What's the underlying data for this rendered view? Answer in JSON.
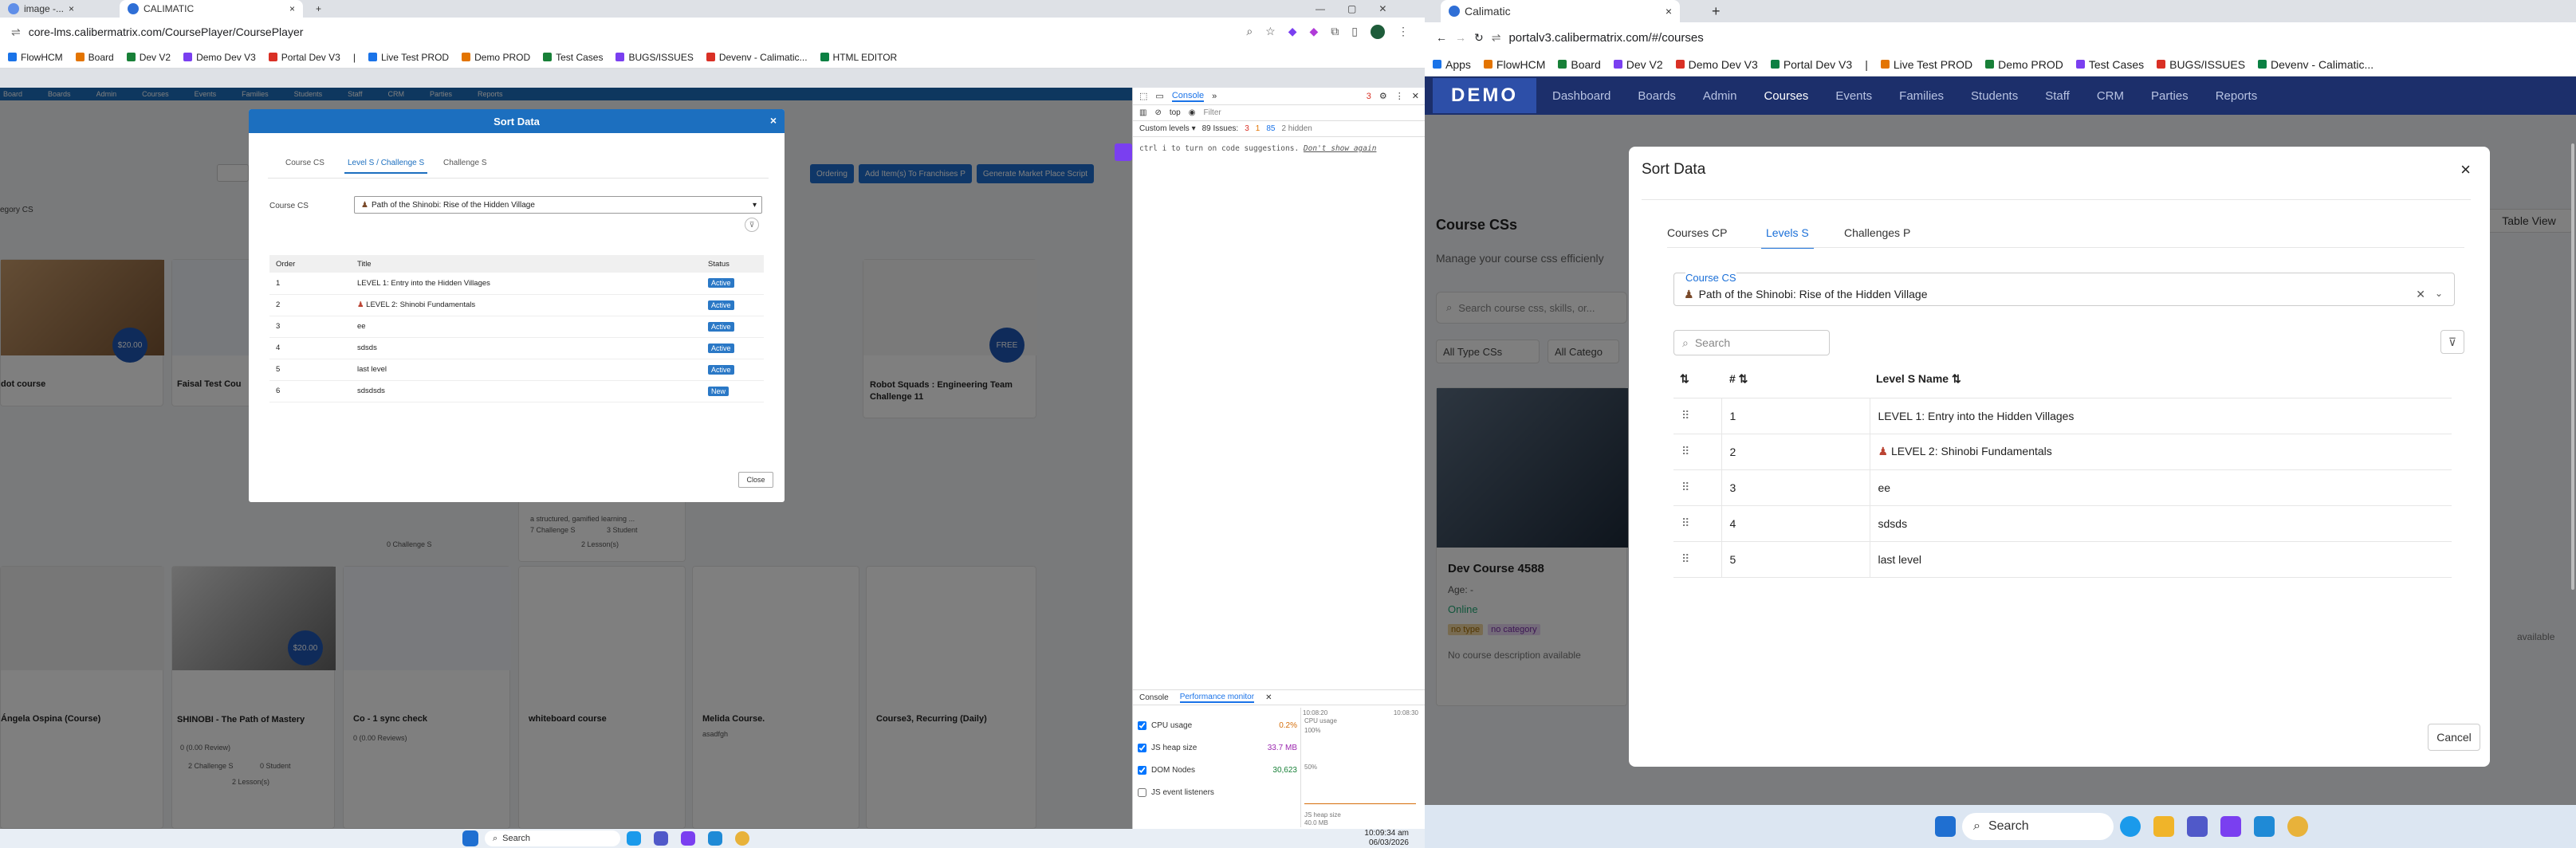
{
  "left": {
    "tabs": [
      {
        "label": "image -..."
      },
      {
        "label": "CALIMATIC"
      }
    ],
    "url": "core-lms.calibermatrix.com/CoursePlayer/CoursePlayer",
    "bookmarks": [
      "FlowHCM",
      "Board",
      "Dev V2",
      "Demo Dev V3",
      "Portal Dev V3",
      "|",
      "Live Test PROD",
      "Demo PROD",
      "Test Cases",
      "BUGS/ISSUES",
      "Devenv - Calimatic...",
      "HTML EDITOR"
    ],
    "nav": [
      "Board",
      "Boards",
      "Admin",
      "Courses",
      "Events",
      "Families",
      "Students",
      "Staff",
      "CRM",
      "Parties",
      "Reports"
    ],
    "actions": [
      "Ordering",
      "Add Item(s) To Franchises P",
      "Generate Market Place Script"
    ],
    "category_label": "egory CS",
    "cards_row1": [
      {
        "title": "dot course",
        "price": "$20.00"
      },
      {
        "title": "Faisal Test Cou"
      },
      {
        "title": "Robot Squads : Engineering Team Challenge 11",
        "price": "FREE"
      }
    ],
    "cards_row2": [
      {
        "title": "Ángela Ospina (Course)"
      },
      {
        "title": "SHINOBI - The Path of Mastery",
        "price": "$20.00",
        "reviews": "0 (0.00 Review)",
        "challenges": "2 Challenge S",
        "students": "0 Student",
        "lessons": "2 Lesson(s)"
      },
      {
        "title": "Co - 1 sync check",
        "reviews": "0 (0.00 Reviews)"
      },
      {
        "title": "whiteboard course"
      },
      {
        "title": "Melida Course.",
        "sub": "asadfgh"
      },
      {
        "title": "Course3, Recurring (Daily)"
      }
    ],
    "mid_card_text": [
      "a structured, gamified learning ...",
      "7 Challenge S",
      "3 Student",
      "2 Lesson(s)",
      "0 Challenge S"
    ],
    "modal": {
      "title": "Sort Data",
      "close": "×",
      "tabs": [
        "Course CS",
        "Level S / Challenge S",
        "Challenge S"
      ],
      "field_label": "Course CS",
      "selected": "Path of the Shinobi: Rise of the Hidden Village",
      "headers": [
        "Order",
        "Title",
        "Status"
      ],
      "rows": [
        {
          "order": "1",
          "title": "LEVEL 1: Entry into the Hidden Villages",
          "status": "Active"
        },
        {
          "order": "2",
          "title": "LEVEL 2: Shinobi Fundamentals",
          "status": "Active"
        },
        {
          "order": "3",
          "title": "ee",
          "status": "Active"
        },
        {
          "order": "4",
          "title": "sdsds",
          "status": "Active"
        },
        {
          "order": "5",
          "title": "last level",
          "status": "Active"
        },
        {
          "order": "6",
          "title": "sdsdsds",
          "status": "New"
        }
      ],
      "close_btn": "Close"
    },
    "devtools": {
      "tab": "Console",
      "context": "top",
      "filter": "Filter",
      "levels": "Custom levels ▾",
      "issues": "89 Issues:",
      "issue_counts": [
        "3",
        "1",
        "85"
      ],
      "hidden": "2 hidden",
      "console_line": "ctrl i  to turn on code suggestions.",
      "dont_show": "Don't show again",
      "bottom_tabs": [
        "Console",
        "Performance monitor"
      ],
      "metrics": [
        {
          "name": "CPU usage",
          "value": "0.2%",
          "checked": true,
          "color": "#d56e0b"
        },
        {
          "name": "JS heap size",
          "value": "33.7 MB",
          "checked": true,
          "color": "#9b27af"
        },
        {
          "name": "DOM Nodes",
          "value": "30,623",
          "checked": true,
          "color": "#188038"
        },
        {
          "name": "JS event listeners",
          "value": "",
          "checked": false,
          "color": "#1a73e8"
        }
      ],
      "graph": {
        "time1": "10:08:20",
        "time2": "10:08:30",
        "cpu": "CPU usage",
        "pct100": "100%",
        "pct50": "50%",
        "heap": "JS heap size",
        "heapval": "40.0 MB"
      }
    },
    "taskbar": {
      "search": "Search",
      "time": "10:09:34 am",
      "date": "06/03/2026"
    }
  },
  "right": {
    "tab": "Calimatic",
    "url": "portalv3.calibermatrix.com/#/courses",
    "bookmarks": [
      "Apps",
      "FlowHCM",
      "Board",
      "Dev V2",
      "Demo Dev V3",
      "Portal Dev V3",
      "|",
      "Live Test PROD",
      "Demo PROD",
      "Test Cases",
      "BUGS/ISSUES",
      "Devenv - Calimatic..."
    ],
    "nav": [
      "Dashboard",
      "Boards",
      "Admin",
      "Courses",
      "Events",
      "Families",
      "Students",
      "Staff",
      "CRM",
      "Parties",
      "Reports"
    ],
    "logo": "DEMO",
    "page_title": "Course CSs",
    "page_sub": "Manage your course css efficienly",
    "search_placeholder": "Search course css, skills, or...",
    "filter1": "All Type CSs",
    "filter2": "All Catego",
    "table_view": "Table View",
    "course": {
      "name": "Dev Course 4588",
      "age": "Age: -",
      "mode": "Online",
      "tags": [
        "no type",
        "no category"
      ],
      "desc": "No course description available",
      "avail": "available"
    },
    "modal": {
      "title": "Sort Data",
      "close": "×",
      "tabs": [
        "Courses CP",
        "Levels S",
        "Challenges P"
      ],
      "field_label": "Course CS",
      "selected": "Path of the Shinobi: Rise of the Hidden Village",
      "search": "Search",
      "headers": [
        "#",
        "Level S Name"
      ],
      "rows": [
        {
          "n": "1",
          "name": "LEVEL 1: Entry into the Hidden Villages"
        },
        {
          "n": "2",
          "name": "LEVEL 2: Shinobi Fundamentals"
        },
        {
          "n": "3",
          "name": "ee"
        },
        {
          "n": "4",
          "name": "sdsds"
        },
        {
          "n": "5",
          "name": "last level"
        }
      ],
      "cancel": "Cancel"
    },
    "taskbar": {
      "search": "Search"
    }
  },
  "colors": {
    "brand_blue": "#1c6fbf",
    "active_green": "#3c9a5f",
    "new_blue": "#2a78c6",
    "primary": "#1f6fd1"
  }
}
